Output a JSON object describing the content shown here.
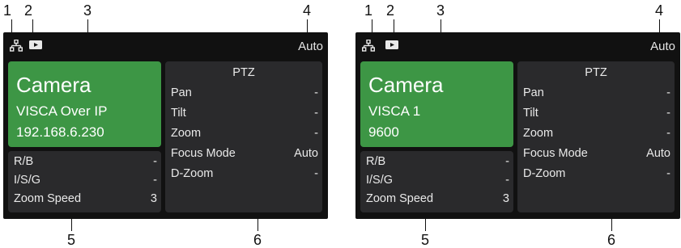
{
  "callouts": [
    "1",
    "2",
    "3",
    "4",
    "5",
    "6"
  ],
  "colors": {
    "camera_panel": "#3d9645",
    "panel": "#2a2a2c",
    "screen": "#111111"
  },
  "screens": [
    {
      "status": {
        "network_icon": "network-icon",
        "record_icon": "record-icon",
        "mode": "Auto"
      },
      "camera": {
        "title": "Camera",
        "line1": "VISCA Over IP",
        "line2": "192.168.6.230"
      },
      "info": [
        {
          "label": "R/B",
          "value": "-"
        },
        {
          "label": "I/S/G",
          "value": "-"
        },
        {
          "label": "Zoom Speed",
          "value": "3"
        }
      ],
      "ptz": {
        "title": "PTZ",
        "rows": [
          {
            "label": "Pan",
            "value": "-"
          },
          {
            "label": "Tilt",
            "value": "-"
          },
          {
            "label": "Zoom",
            "value": "-"
          },
          {
            "label": "Focus Mode",
            "value": "Auto"
          },
          {
            "label": "D-Zoom",
            "value": "-"
          }
        ]
      }
    },
    {
      "status": {
        "network_icon": "network-icon",
        "record_icon": "record-icon",
        "mode": "Auto"
      },
      "camera": {
        "title": "Camera",
        "line1": "VISCA 1",
        "line2": "9600"
      },
      "info": [
        {
          "label": "R/B",
          "value": "-"
        },
        {
          "label": "I/S/G",
          "value": "-"
        },
        {
          "label": "Zoom Speed",
          "value": "3"
        }
      ],
      "ptz": {
        "title": "PTZ",
        "rows": [
          {
            "label": "Pan",
            "value": "-"
          },
          {
            "label": "Tilt",
            "value": "-"
          },
          {
            "label": "Zoom",
            "value": "-"
          },
          {
            "label": "Focus Mode",
            "value": "Auto"
          },
          {
            "label": "D-Zoom",
            "value": "-"
          }
        ]
      }
    }
  ]
}
